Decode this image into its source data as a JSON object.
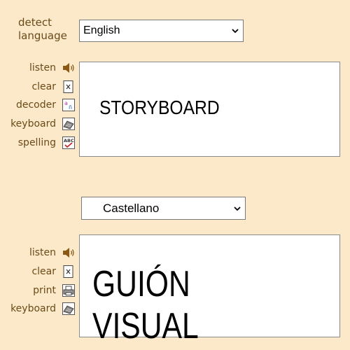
{
  "source_panel": {
    "detect_label": "detect language",
    "language_select": {
      "selected": "English"
    },
    "tools": [
      {
        "label": "listen",
        "icon": "speaker-icon"
      },
      {
        "label": "clear",
        "icon": "clear-document-icon"
      },
      {
        "label": "decoder",
        "icon": "decoder-icon"
      },
      {
        "label": "keyboard",
        "icon": "keyboard-icon"
      },
      {
        "label": "spelling",
        "icon": "spellcheck-icon"
      }
    ],
    "text": "STORYBOARD"
  },
  "target_panel": {
    "language_select": {
      "selected": "Castellano"
    },
    "tools": [
      {
        "label": "listen",
        "icon": "speaker-icon"
      },
      {
        "label": "clear",
        "icon": "clear-document-icon"
      },
      {
        "label": "print",
        "icon": "printer-icon"
      },
      {
        "label": "keyboard",
        "icon": "keyboard-icon"
      }
    ],
    "text": "GUIÓN VISUAL"
  },
  "colors": {
    "background": "#fbe9c9",
    "label_text": "#6b4a1a",
    "icon_brown": "#8a5a14"
  }
}
